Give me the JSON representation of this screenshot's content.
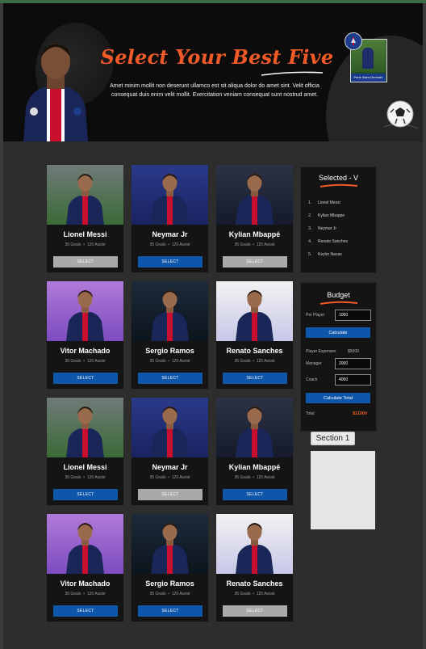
{
  "header": {
    "title": "Select Your Best Five",
    "subtitle": "Amet minim mollit non deserunt ullamco est sit aliqua dolor do amet sint. Velit officia consequat duis enim velit mollit. Exercitation veniam consequat sunt nostrud amet.",
    "club_card_caption": "Paris Saint-Germain"
  },
  "cards": [
    {
      "name": "Lionel Messi",
      "goals": "35 Goals",
      "assist": "120 Assist",
      "button": "SELECT",
      "disabled": true,
      "photo": "green"
    },
    {
      "name": "Neymar Jr",
      "goals": "35 Goals",
      "assist": "120 Assist",
      "button": "SELECT",
      "disabled": false,
      "photo": "blue"
    },
    {
      "name": "Kylian Mbappé",
      "goals": "35 Goals",
      "assist": "120 Assist",
      "button": "SELECT",
      "disabled": true,
      "photo": "dark"
    },
    {
      "name": "Vitor Machado",
      "goals": "35 Goals",
      "assist": "120 Assist",
      "button": "SELECT",
      "disabled": false,
      "photo": "purple"
    },
    {
      "name": "Sergio Ramos",
      "goals": "35 Goals",
      "assist": "120 Assist",
      "button": "SELECT",
      "disabled": false,
      "photo": "night"
    },
    {
      "name": "Renato Sanches",
      "goals": "35 Goals",
      "assist": "120 Assist",
      "button": "SELECT",
      "disabled": false,
      "photo": "white"
    },
    {
      "name": "Lionel Messi",
      "goals": "35 Goals",
      "assist": "120 Assist",
      "button": "SELECT",
      "disabled": false,
      "photo": "green"
    },
    {
      "name": "Neymar Jr",
      "goals": "35 Goals",
      "assist": "120 Assist",
      "button": "SELECT",
      "disabled": true,
      "photo": "blue"
    },
    {
      "name": "Kylian Mbappé",
      "goals": "35 Goals",
      "assist": "120 Assist",
      "button": "SELECT",
      "disabled": false,
      "photo": "dark"
    },
    {
      "name": "Vitor Machado",
      "goals": "35 Goals",
      "assist": "120 Assist",
      "button": "SELECT",
      "disabled": false,
      "photo": "purple"
    },
    {
      "name": "Sergio Ramos",
      "goals": "35 Goals",
      "assist": "120 Assist",
      "button": "SELECT",
      "disabled": false,
      "photo": "night"
    },
    {
      "name": "Renato Sanches",
      "goals": "35 Goals",
      "assist": "120 Assist",
      "button": "SELECT",
      "disabled": true,
      "photo": "white"
    }
  ],
  "selected": {
    "title": "Selected - V",
    "items": [
      "Lionel Messi",
      "Kylian Mbappe",
      "Neymar Jr",
      "Renato Sanches",
      "Keylor Navas"
    ]
  },
  "budget": {
    "title": "Budget",
    "per_player_label": "Per Player",
    "per_player_value": "1000",
    "calculate_label": "Calculate",
    "player_expenses_label": "Player Expenses",
    "player_expenses_value": "$5000",
    "manager_label": "Manager",
    "manager_value": "2000",
    "coach_label": "Coach",
    "coach_value": "4000",
    "calculate_total_label": "Calculate Total",
    "total_label": "Total",
    "total_value": "$11000"
  },
  "section": {
    "label": "Section 1"
  },
  "colors": {
    "accent": "#f05a28",
    "primary_button": "#0f55a9",
    "disabled_button": "#a9a9a9",
    "page_bg": "#2d2d2d",
    "header_bg": "#0c0c0c",
    "card_bg": "#141414"
  },
  "icons": [
    "psg-crest-icon",
    "football-icon",
    "swoosh-underline-icon"
  ]
}
